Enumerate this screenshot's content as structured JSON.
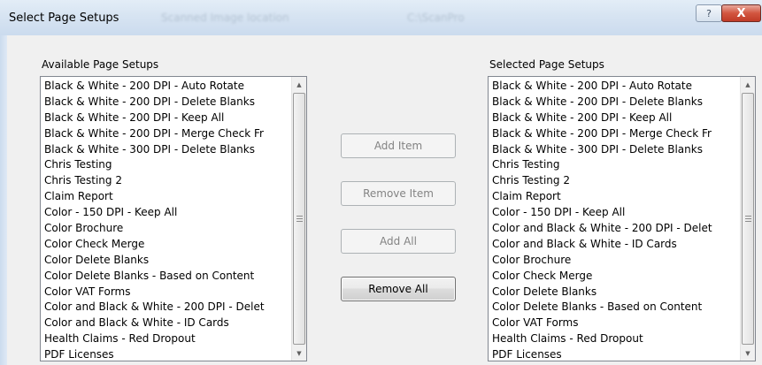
{
  "window": {
    "title": "Select Page Setups",
    "ghost_texts": [
      "Scanned Image location",
      "C:\\ScanPro"
    ],
    "help_label": "?",
    "close_label": "X"
  },
  "available": {
    "label": "Available Page Setups",
    "items": [
      "Black & White - 200 DPI - Auto Rotate",
      "Black & White - 200 DPI - Delete Blanks",
      "Black & White - 200 DPI - Keep All",
      "Black & White - 200 DPI - Merge Check Fr",
      "Black & White - 300 DPI - Delete Blanks",
      "Chris Testing",
      "Chris Testing 2",
      "Claim Report",
      "Color - 150 DPI - Keep All",
      "Color Brochure",
      "Color Check Merge",
      "Color Delete Blanks",
      "Color Delete Blanks - Based on Content",
      "Color VAT Forms",
      "Color and Black & White - 200 DPI - Delet",
      "Color and Black & White - ID Cards",
      "Health Claims - Red Dropout",
      "PDF Licenses"
    ]
  },
  "selected": {
    "label": "Selected Page Setups",
    "items": [
      "Black & White - 200 DPI - Auto Rotate",
      "Black & White - 200 DPI - Delete Blanks",
      "Black & White - 200 DPI - Keep All",
      "Black & White - 200 DPI - Merge Check Fr",
      "Black & White - 300 DPI - Delete Blanks",
      "Chris Testing",
      "Chris Testing 2",
      "Claim Report",
      "Color - 150 DPI - Keep All",
      "Color and Black & White - 200 DPI - Delet",
      "Color and Black & White - ID Cards",
      "Color Brochure",
      "Color Check Merge",
      "Color Delete Blanks",
      "Color Delete Blanks - Based on Content",
      "Color VAT Forms",
      "Health Claims - Red Dropout",
      "PDF Licenses"
    ]
  },
  "buttons": {
    "add_item": "Add Item",
    "remove_item": "Remove Item",
    "add_all": "Add All",
    "remove_all": "Remove All"
  },
  "icons": {
    "scroll_up": "▲",
    "scroll_down": "▼"
  },
  "colors": {
    "title_bar": "#d7e4f2",
    "close_button": "#c74b36",
    "disabled_text": "#838383",
    "listbox_border": "#828790"
  }
}
